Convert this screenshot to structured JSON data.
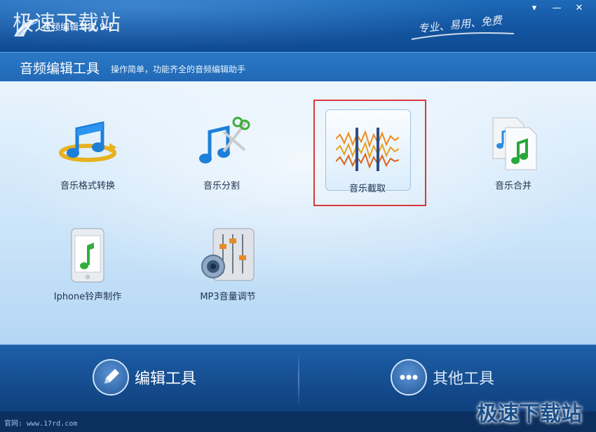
{
  "titlebar": {
    "watermark": "极速下载站",
    "app_title": "音频编辑专家 9.2",
    "slogan": "专业、易用、免费",
    "controls": {
      "menu": "▾",
      "minimize": "—",
      "close": "✕"
    }
  },
  "header": {
    "title": "音频编辑工具",
    "subtitle": "操作简单，功能齐全的音频编辑助手"
  },
  "tools": [
    {
      "label": "音乐格式转换",
      "icon": "music-convert-icon"
    },
    {
      "label": "音乐分割",
      "icon": "music-split-icon"
    },
    {
      "label": "音乐截取",
      "icon": "music-cut-icon",
      "selected": true
    },
    {
      "label": "音乐合并",
      "icon": "music-merge-icon"
    },
    {
      "label": "Iphone铃声制作",
      "icon": "iphone-ringtone-icon"
    },
    {
      "label": "MP3音量调节",
      "icon": "mp3-volume-icon"
    }
  ],
  "nav": {
    "edit_tools": "编辑工具",
    "other_tools": "其他工具"
  },
  "status": {
    "url": "官网: www.17rd.com"
  },
  "watermark_bottom": "极速下载站",
  "colors": {
    "title_blue": "#1559a6",
    "header_blue": "#2068b6",
    "highlight_red": "#d8393a",
    "nav_blue": "#164f92"
  }
}
